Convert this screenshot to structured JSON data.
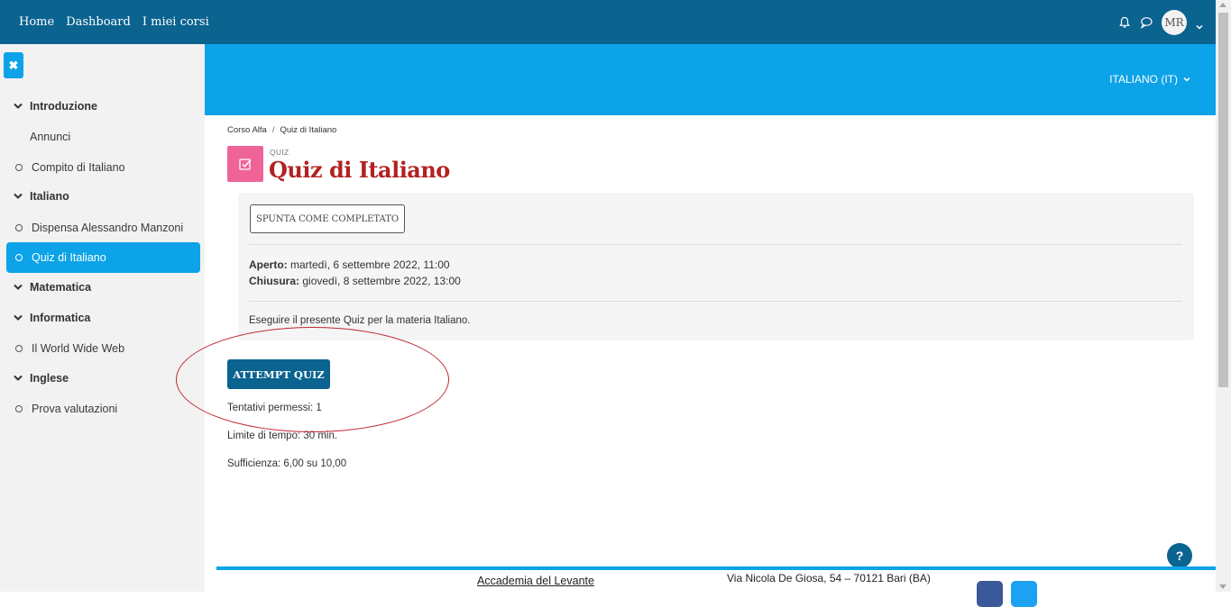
{
  "navbar": {
    "links": [
      "Home",
      "Dashboard",
      "I miei corsi"
    ],
    "avatar_initials": "MR"
  },
  "drawer": {
    "close_label": "✖",
    "items": [
      {
        "label": "Introduzione",
        "kind": "section"
      },
      {
        "label": "Annunci",
        "kind": "plain"
      },
      {
        "label": "Compito di Italiano",
        "kind": "activity"
      },
      {
        "label": "Italiano",
        "kind": "section"
      },
      {
        "label": "Dispensa Alessandro Manzoni",
        "kind": "activity"
      },
      {
        "label": "Quiz di Italiano",
        "kind": "activity",
        "active": true
      },
      {
        "label": "Matematica",
        "kind": "section"
      },
      {
        "label": "Informatica",
        "kind": "section"
      },
      {
        "label": "Il World Wide Web",
        "kind": "activity"
      },
      {
        "label": "Inglese",
        "kind": "section"
      },
      {
        "label": "Prova valutazioni",
        "kind": "activity"
      }
    ]
  },
  "header": {
    "language": "ITALIANO (IT)"
  },
  "breadcrumb": [
    "Corso Alfa",
    "Quiz di Italiano"
  ],
  "activity": {
    "type_label": "QUIZ",
    "title": "Quiz di Italiano",
    "complete_button": "SPUNTA COME COMPLETATO",
    "opened_label": "Aperto:",
    "opened_value": " martedì, 6 settembre 2022, 11:00",
    "closed_label": "Chiusura:",
    "closed_value": " giovedì, 8 settembre 2022, 13:00",
    "description": "Eseguire il presente Quiz per la materia Italiano.",
    "attempt_button": "ATTEMPT QUIZ",
    "attempts_allowed": "Tentativi permessi: 1",
    "time_limit": "Limite di tempo: 30 min.",
    "pass_grade": "Sufficienza: 6,00 su 10,00"
  },
  "help_label": "?",
  "footer": {
    "name": "Accademia del Levante",
    "address": "Via Nicola De Giosa, 54 – 70121 Bari (BA)"
  },
  "colors": {
    "navbar": "#0b6390",
    "accent": "#0ca3e8",
    "title": "#b22222",
    "quiz_icon": "#f06399"
  }
}
